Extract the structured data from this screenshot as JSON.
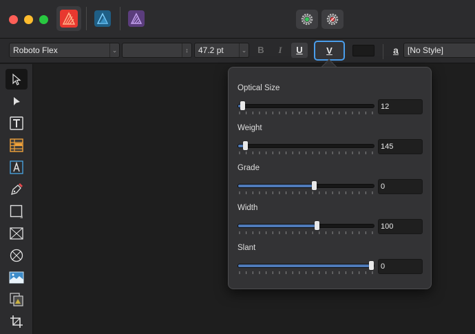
{
  "toolbar": {
    "font_family": "Roboto Flex",
    "font_style": "",
    "font_size": "47.2 pt",
    "bold_label": "B",
    "italic_label": "I",
    "underline_label": "U",
    "variable_label": "V",
    "style_icon_label": "a",
    "paragraph_style": "[No Style]"
  },
  "variable_font": {
    "axes": [
      {
        "label": "Optical Size",
        "value": "12",
        "level": 0.03
      },
      {
        "label": "Weight",
        "value": "145",
        "level": 0.05
      },
      {
        "label": "Grade",
        "value": "0",
        "level": 0.56
      },
      {
        "label": "Width",
        "value": "100",
        "level": 0.58
      },
      {
        "label": "Slant",
        "value": "0",
        "level": 0.98
      }
    ]
  },
  "colors": {
    "accent": "#4a9eed",
    "slider_fill": "#4f7ab8"
  },
  "icons": {
    "personas": [
      "designer-persona-icon",
      "publisher-persona-icon",
      "photo-persona-icon"
    ],
    "settings": [
      "preferences-gear-icon",
      "snapping-gear-icon"
    ],
    "tools": [
      "move-tool-icon",
      "node-tool-icon",
      "artistic-text-tool-icon",
      "table-tool-icon",
      "frame-text-tool-icon",
      "pen-tool-icon",
      "rectangle-tool-icon",
      "picture-frame-tool-icon",
      "ellipse-frame-tool-icon",
      "place-image-tool-icon",
      "content-tool-icon",
      "crop-tool-icon"
    ]
  }
}
